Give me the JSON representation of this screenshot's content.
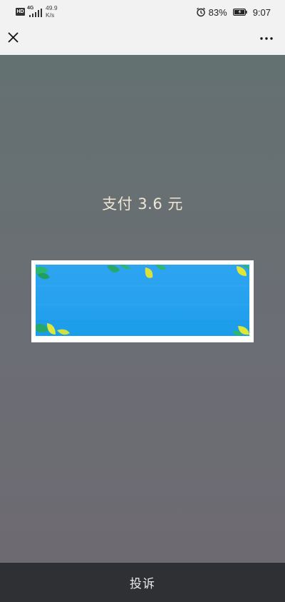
{
  "status_bar": {
    "hd": "HD",
    "network_type": "4G",
    "speed_value": "49.9",
    "speed_unit": "K/s",
    "battery_percent": "83%",
    "time": "9:07"
  },
  "nav": {
    "close_icon": "close-icon",
    "more_icon": "more-icon"
  },
  "payment": {
    "title": "支付 3.6 元"
  },
  "banner": {
    "icon": "leaves-decoration"
  },
  "bottom_bar": {
    "complaint_label": "投诉"
  },
  "colors": {
    "background_top": "#647171",
    "background_bottom": "#6e6a72",
    "title_text": "#efe6d5",
    "banner_blue": "#25a1ee",
    "bottom_bar": "#2f3033"
  }
}
